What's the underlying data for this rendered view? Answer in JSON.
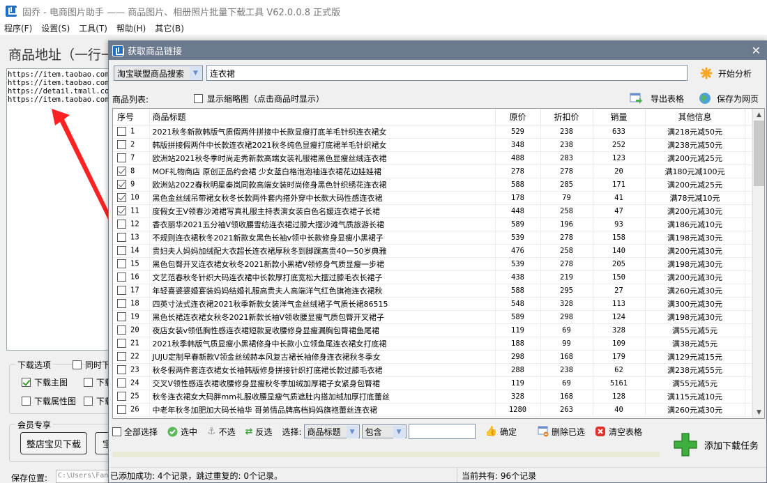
{
  "app": {
    "title": "固乔 - 电商图片助手 —— 商品图片、相册照片批量下载工具 V62.0.0.8 正式版",
    "menu": [
      "程序(F)",
      "设置(S)",
      "工具(T)",
      "帮助(H)",
      "其它(B)"
    ],
    "heading": "商品地址（一行一",
    "urls": [
      "https://item.taobao.com/",
      "https://item.taobao.com/",
      "https://detail.tmall.com",
      "https://item.taobao.com/"
    ],
    "download_options": {
      "legend": "下载选项",
      "simultaneous": "同时下",
      "main_image": {
        "label": "下载主图",
        "checked": true
      },
      "opt2": "下载",
      "attr_image": {
        "label": "下载属性图",
        "checked": false
      },
      "opt4": "下载"
    },
    "member": {
      "legend": "会员专享",
      "shop_download": "整店宝贝下载",
      "second_btn": "宝"
    },
    "save": {
      "label": "保存位置:",
      "path": "C:\\Users\\Fan"
    }
  },
  "dialog": {
    "title": "获取商品链接",
    "close": "✕",
    "search_type": "淘宝联盟商品搜索",
    "keyword": "连衣裙",
    "start_analysis": "开始分析",
    "list_label": "商品列表:",
    "show_thumbnails": "显示缩略图（点击商品时显示）",
    "export_table": "导出表格",
    "save_webpage": "保存为网页",
    "columns": [
      "序号",
      "商品标题",
      "原价",
      "折扣价",
      "销量",
      "其他信息"
    ],
    "rows": [
      {
        "checked": false,
        "idx": "1",
        "title": "2021秋冬新款韩版气质假两件拼接中长款显瘦打底羊毛针织连衣裙女",
        "price": "529",
        "discount": "238",
        "sales": "633",
        "info": "满218元减50元"
      },
      {
        "checked": false,
        "idx": "2",
        "title": "韩版拼接假两件中长款连衣裙2021秋冬纯色显瘦打底裙羊毛针织裙女",
        "price": "348",
        "discount": "238",
        "sales": "252",
        "info": "满238元减50元"
      },
      {
        "checked": false,
        "idx": "7",
        "title": "欧洲站2021秋冬季时尚走秀新款高端女装礼服裙黑色显瘦丝绒连衣裙",
        "price": "488",
        "discount": "283",
        "sales": "123",
        "info": "满200元减25元"
      },
      {
        "checked": true,
        "idx": "8",
        "title": "MOF礼物商店 原创正品约会裙 少女蓝白格泡泡袖连衣裙花边娃娃裙",
        "price": "278",
        "discount": "278",
        "sales": "20",
        "info": "满180元减100元"
      },
      {
        "checked": true,
        "idx": "9",
        "title": "欧洲站2022春秋明星秦岚同款高端女装时尚修身黑色针织绣花连衣裙",
        "price": "588",
        "discount": "285",
        "sales": "171",
        "info": "满200元减25元"
      },
      {
        "checked": true,
        "idx": "10",
        "title": "黑色金丝绒吊带裙女秋冬长款两件套内搭外穿中长款大码性感连衣裙",
        "price": "178",
        "discount": "79",
        "sales": "41",
        "info": "满78元减10元"
      },
      {
        "checked": true,
        "idx": "11",
        "title": "度假女王V领春沙滩裙写真礼服主持表演女装白色名媛连衣裙子长裙",
        "price": "448",
        "discount": "258",
        "sales": "47",
        "info": "满200元减30元"
      },
      {
        "checked": false,
        "idx": "12",
        "title": "香衣丽华2021五分袖V领收腰雪纺连衣裙过膝大摆沙滩气质旅游长裙",
        "price": "589",
        "discount": "196",
        "sales": "93",
        "info": "满186元减10元"
      },
      {
        "checked": false,
        "idx": "13",
        "title": "不规则连衣裙秋冬2021新款女黑色长袖v领中长款修身显瘦小黑裙子",
        "price": "539",
        "discount": "278",
        "sales": "158",
        "info": "满198元减30元"
      },
      {
        "checked": false,
        "idx": "14",
        "title": "贵妇夫人妈妈加绒配大衣超长连衣裙厚秋冬到脚踝高贵40一50岁典雅",
        "price": "476",
        "discount": "258",
        "sales": "140",
        "info": "满200元减30元"
      },
      {
        "checked": false,
        "idx": "15",
        "title": "黑色包臀开叉连衣裙女秋冬2021新款小黑裙V领修身气质显瘦一步裙",
        "price": "539",
        "discount": "278",
        "sales": "205",
        "info": "满198元减30元"
      },
      {
        "checked": false,
        "idx": "16",
        "title": "文艺范春秋冬针织大码连衣裙中长款厚打底宽松大摆过膝毛衣长裙子",
        "price": "438",
        "discount": "219",
        "sales": "150",
        "info": "满200元减30元"
      },
      {
        "checked": false,
        "idx": "17",
        "title": "年轻喜婆婆婚宴装妈妈结婚礼服高贵夫人高端洋气红色旗袍连衣裙秋",
        "price": "588",
        "discount": "295",
        "sales": "27",
        "info": "满260元减30元"
      },
      {
        "checked": false,
        "idx": "18",
        "title": "四英寸法式连衣裙2021秋季新款女装洋气金丝绒裙子气质长裙86515",
        "price": "548",
        "discount": "328",
        "sales": "113",
        "info": "满300元减30元"
      },
      {
        "checked": false,
        "idx": "19",
        "title": "黑色长裙连衣裙女秋冬2021新款长袖V领收腰显瘦气质包臀开叉裙子",
        "price": "589",
        "discount": "298",
        "sales": "124",
        "info": "满198元减30元"
      },
      {
        "checked": false,
        "idx": "20",
        "title": "夜店女装v领低胸性感连衣裙短款夏收腰修身显瘦漏胸包臀裙鱼尾裙",
        "price": "119",
        "discount": "69",
        "sales": "328",
        "info": "满55元减5元"
      },
      {
        "checked": false,
        "idx": "21",
        "title": "2021秋季韩版气质显瘦小黑裙修身中长款小立领鱼尾连衣裙女打底裙",
        "price": "188",
        "discount": "99",
        "sales": "109",
        "info": "满38元减5元"
      },
      {
        "checked": false,
        "idx": "22",
        "title": "JUJU定制早春新款V领金丝绒赫本风复古裙长袖修身连衣裙秋冬季女",
        "price": "298",
        "discount": "168",
        "sales": "179",
        "info": "满129元减15元"
      },
      {
        "checked": false,
        "idx": "23",
        "title": "秋冬假两件套连衣裙女长袖韩版修身拼接针织打底裙长款过膝毛衣裙",
        "price": "288",
        "discount": "238",
        "sales": "62",
        "info": "满238元减55元"
      },
      {
        "checked": false,
        "idx": "24",
        "title": "交叉V领性感连衣裙收腰修身显瘦秋冬季加绒加厚裙子女紧身包臀裙",
        "price": "119",
        "discount": "69",
        "sales": "5161",
        "info": "满55元减5元"
      },
      {
        "checked": false,
        "idx": "25",
        "title": "秋冬连衣裙女大码胖mm礼服收腰显瘦气质遮肚内搭加绒加厚打底蕾丝",
        "price": "328",
        "discount": "168",
        "sales": "128",
        "info": "满115元减10元"
      },
      {
        "checked": false,
        "idx": "26",
        "title": "中老年秋冬加肥加大码长袖华 哥弟情品牌高档妈妈旗袍蕾丝连衣裙",
        "price": "1280",
        "discount": "263",
        "sales": "40",
        "info": "满260元减30元"
      }
    ],
    "scrollbar": {
      "position": 0.0,
      "visible_fraction": 0.23
    },
    "actions": {
      "select_all": "全部选择",
      "check": "选中",
      "uncheck": "不选",
      "invert": "反选",
      "select_label": "选择:",
      "field": "商品标题",
      "condition": "包含",
      "filter_value": "",
      "confirm": "确定",
      "delete_selected": "删除已选",
      "clear_table": "清空表格",
      "add_task": "添加下载任务"
    },
    "status": {
      "left": "已添加成功: 4个记录，跳过重复的: 0个记录。",
      "right": "当前共有: 96个记录"
    }
  }
}
